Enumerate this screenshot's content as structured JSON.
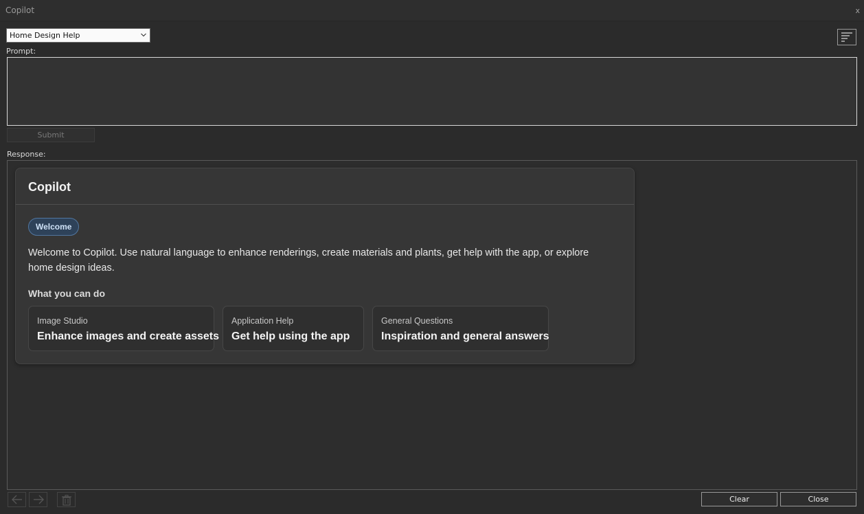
{
  "window": {
    "title": "Copilot",
    "close_glyph": "x"
  },
  "toolbar": {
    "mode_selected": "Home Design Help",
    "menu_icon": "filter-lines-icon"
  },
  "prompt": {
    "label": "Prompt:",
    "value": "",
    "submit_label": "Submit"
  },
  "response": {
    "label": "Response:",
    "card": {
      "title": "Copilot",
      "badge": "Welcome",
      "description": "Welcome to Copilot. Use natural language to enhance renderings, create materials and plants, get help with the app, or explore home design ideas.",
      "subheading": "What you can do",
      "features": [
        {
          "category": "Image Studio",
          "title": "Enhance images and create assets"
        },
        {
          "category": "Application Help",
          "title": "Get help using the app"
        },
        {
          "category": "General Questions",
          "title": "Inspiration and general answers"
        }
      ]
    }
  },
  "footer": {
    "back_icon": "arrow-left-icon",
    "forward_icon": "arrow-right-icon",
    "delete_icon": "trash-icon",
    "clear_label": "Clear",
    "close_label": "Close"
  },
  "colors": {
    "background": "#2b2b2b",
    "card": "#363636",
    "badge_bg": "#2e4259",
    "badge_border": "#5277a0"
  }
}
